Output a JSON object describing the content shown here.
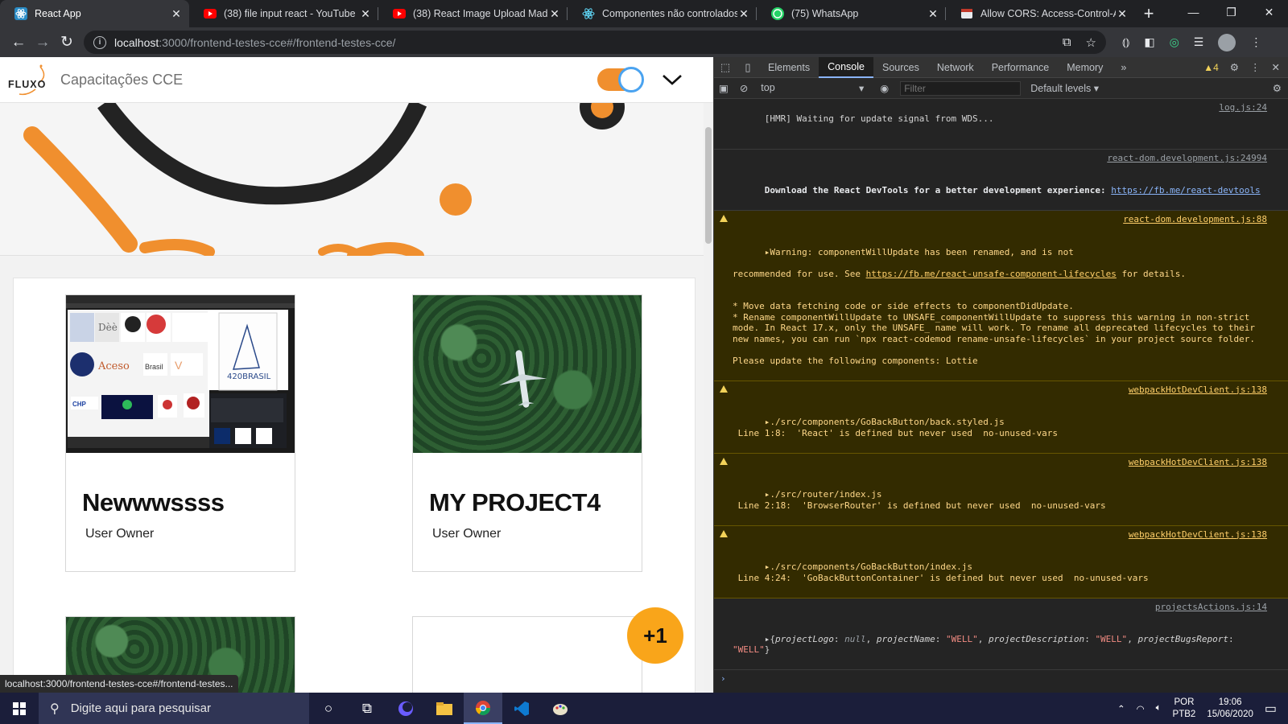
{
  "tabs": [
    {
      "title": "React App",
      "active": true
    },
    {
      "title": "(38) file input react - YouTube",
      "active": false
    },
    {
      "title": "(38) React Image Upload Made",
      "active": false
    },
    {
      "title": "Componentes não controlados",
      "active": false
    },
    {
      "title": "(75) WhatsApp",
      "active": false
    },
    {
      "title": "Allow CORS: Access-Control-Al",
      "active": false
    }
  ],
  "tab_close": "✕",
  "new_tab": "+",
  "window_controls": {
    "minimize": "—",
    "maximize": "❐",
    "close": "✕"
  },
  "address": {
    "host": "localhost",
    "rest": ":3000/frontend-testes-cce#/frontend-testes-cce/"
  },
  "app": {
    "logo_text": "FLUXO",
    "title": "Capacitações CCE",
    "toggle_on": true
  },
  "projects": [
    {
      "name": "Newwwssss",
      "owner": "User Owner"
    },
    {
      "name": "MY PROJECT4",
      "owner": "User Owner"
    }
  ],
  "fab_label": "+1",
  "status_url": "localhost:3000/frontend-testes-cce#/frontend-testes...",
  "devtools": {
    "tabs": [
      "Elements",
      "Console",
      "Sources",
      "Network",
      "Performance",
      "Memory"
    ],
    "active_tab": "Console",
    "more": "»",
    "warning_count": "4",
    "context": "top",
    "filter_placeholder": "Filter",
    "levels": "Default levels ▾",
    "messages": [
      {
        "type": "log",
        "text": "[HMR] Waiting for update signal from WDS...",
        "source": "log.js:24"
      },
      {
        "type": "log",
        "bold": "Download the React DevTools for a better development experience: ",
        "link": "https://fb.me/react-devtools",
        "source": "react-dom.development.js:24994"
      },
      {
        "type": "warn",
        "line1": "▸Warning: componentWillUpdate has been renamed, and is not",
        "line2a": "recommended for use. See ",
        "line2link": "https://fb.me/react-unsafe-component-lifecycles",
        "line2b": " for details.",
        "body": "\n* Move data fetching code or side effects to componentDidUpdate.\n* Rename componentWillUpdate to UNSAFE_componentWillUpdate to suppress this warning in non-strict mode. In React 17.x, only the UNSAFE_ name will work. To rename all deprecated lifecycles to their new names, you can run `npx react-codemod rename-unsafe-lifecycles` in your project source folder.\n\nPlease update the following components: Lottie",
        "source": "react-dom.development.js:88"
      },
      {
        "type": "warn",
        "line1": "▸./src/components/GoBackButton/back.styled.js",
        "line2": " Line 1:8:  'React' is defined but never used  no-unused-vars",
        "source": "webpackHotDevClient.js:138"
      },
      {
        "type": "warn",
        "line1": "▸./src/router/index.js",
        "line2": " Line 2:18:  'BrowserRouter' is defined but never used  no-unused-vars",
        "source": "webpackHotDevClient.js:138"
      },
      {
        "type": "warn",
        "line1": "▸./src/components/GoBackButton/index.js",
        "line2": " Line 4:24:  'GoBackButtonContainer' is defined but never used  no-unused-vars",
        "source": "webpackHotDevClient.js:138"
      }
    ],
    "object_log": {
      "source": "projectsActions.js:14",
      "prefix": "▸{",
      "k1": "projectLogo",
      "v1": "null",
      "k2": "projectName",
      "v2": "\"WELL\"",
      "k3": "projectDescription",
      "v3": "\"WELL\"",
      "k4": "projectBugsReport",
      "v4": "\"WELL\"",
      "suffix": "}"
    },
    "prompt": "›"
  },
  "taskbar": {
    "search_placeholder": "Digite aqui para pesquisar",
    "lang1": "POR",
    "lang2": "PTB2",
    "time": "19:06",
    "date": "15/06/2020"
  },
  "colors": {
    "accent_orange": "#f08f2e",
    "fab": "#f9a51a",
    "warning": "#f2d259"
  }
}
